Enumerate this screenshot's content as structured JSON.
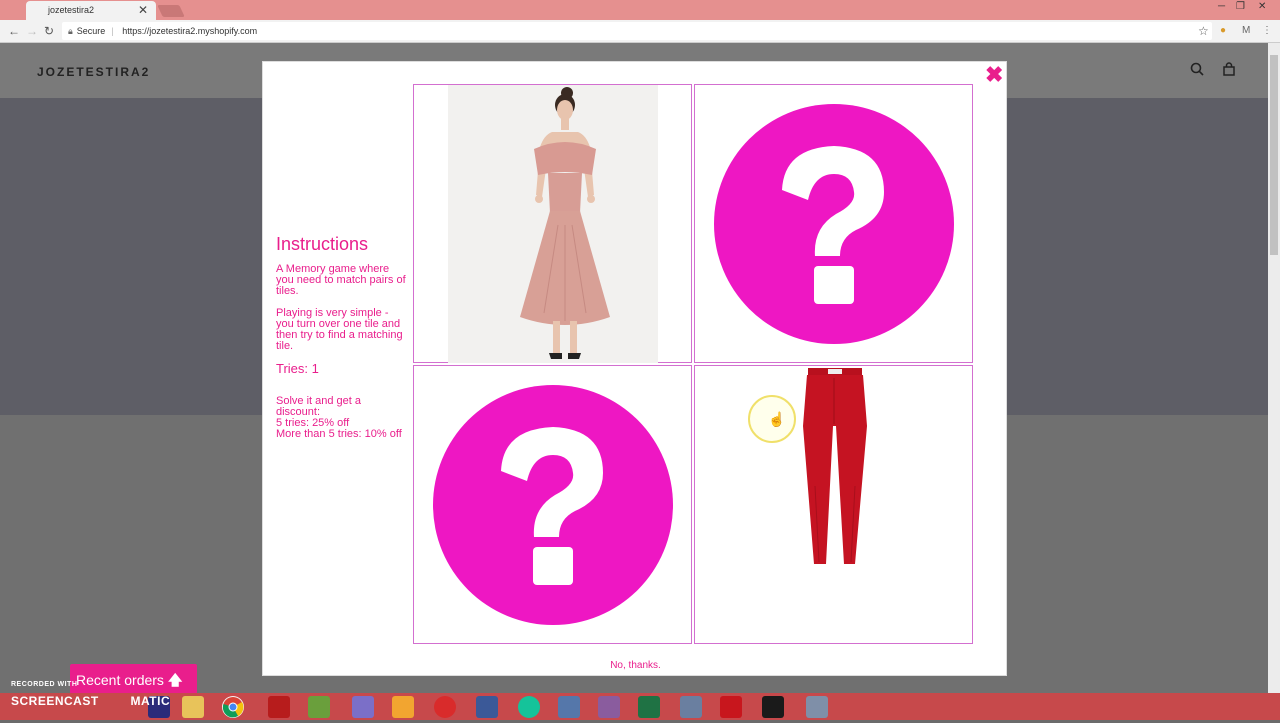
{
  "browser": {
    "tab_title": "jozetestira2",
    "tab_close": "✕",
    "url": "https://jozetestira2.myshopify.com",
    "secure_label": "Secure"
  },
  "store": {
    "logo": "JOZETESTIRA2",
    "search_icon": "search-icon",
    "cart_icon": "cart-icon"
  },
  "modal": {
    "close_label": "✖",
    "instructions_title": "Instructions",
    "paragraph1": "A Memory game where you need to match pairs of tiles.",
    "paragraph2": "Playing is very simple - you turn over one tile and then try to find a matching tile.",
    "tries": "Tries: 1",
    "discount_lines": [
      "Solve it and get a discount:",
      "5 tries: 25% off",
      "More than 5 tries: 10% off"
    ],
    "tiles": [
      {
        "state": "revealed",
        "content": "pink-dress-image"
      },
      {
        "state": "hidden",
        "content": "question-mark"
      },
      {
        "state": "hidden",
        "content": "question-mark"
      },
      {
        "state": "revealed",
        "content": "red-pants-image"
      }
    ],
    "no_thanks": "No, thanks.",
    "accent_color": "#e91e8c"
  },
  "recent_orders": {
    "label": "Recent orders",
    "arrow": "🡅"
  },
  "watermark": {
    "line1": "RECORDED WITH",
    "line2": "SCREENCAST",
    "line3": "MATIC"
  }
}
